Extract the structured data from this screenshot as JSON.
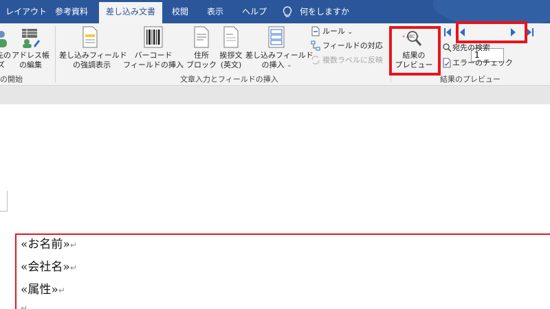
{
  "tabs": [
    {
      "label": "レイアウト"
    },
    {
      "label": "参考資料"
    },
    {
      "label": "差し込み文書"
    },
    {
      "label": "校閲"
    },
    {
      "label": "表示"
    },
    {
      "label": "ヘルプ"
    }
  ],
  "tell_me": "何をしますか",
  "ribbon": {
    "start": {
      "recipients_partial_1": "先の",
      "recipients_partial_2": "ズ",
      "address_book_1": "アドレス帳",
      "address_book_2": "の編集",
      "group_label": "の開始"
    },
    "write": {
      "highlight_1": "差し込みフィールド",
      "highlight_2": "の強調表示",
      "barcode_1": "バーコード",
      "barcode_2": "フィールドの挿入",
      "address_block_1": "住所",
      "address_block_2": "ブロック",
      "greeting_1": "挨拶文",
      "greeting_2": "(英文)",
      "insert_field_1": "差し込みフィールド",
      "insert_field_2": "の挿入",
      "rules": "ルール",
      "match_fields": "フィールドの対応",
      "update_labels": "複数ラベルに反映",
      "group_label": "文章入力とフィールドの挿入"
    },
    "preview": {
      "preview_1": "結果の",
      "preview_2": "プレビュー",
      "find_recipient": "宛先の検索",
      "check_errors": "エラーのチェック",
      "record_value": "1",
      "group_label": "結果のプレビュー"
    }
  },
  "document": {
    "lines": [
      {
        "text": "«お名前»"
      },
      {
        "text": "«会社名»"
      },
      {
        "text": "«属性»"
      }
    ],
    "paragraph_mark": "↵"
  },
  "colors": {
    "tab_bar": "#2b579a",
    "ribbon": "#f3f3f3",
    "highlight": "#e8141b",
    "nav_arrow": "#2b6cc4"
  }
}
